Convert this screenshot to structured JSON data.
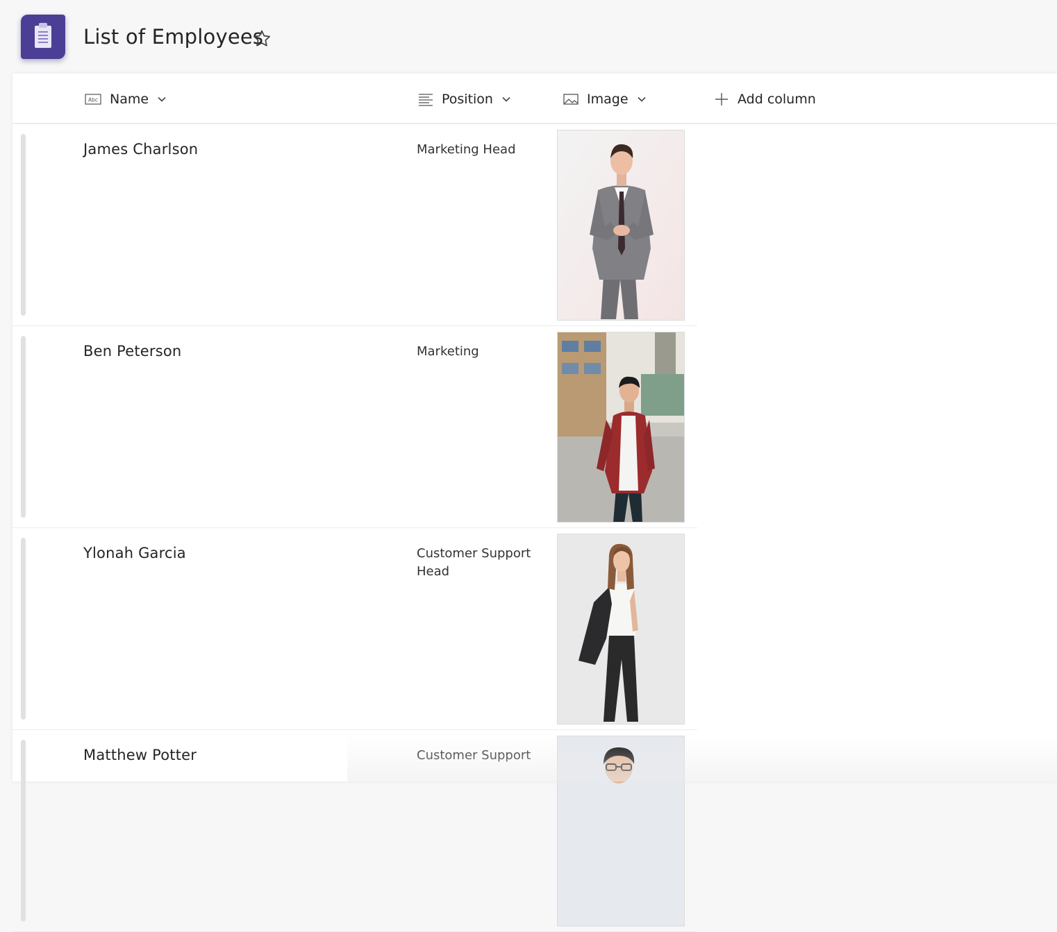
{
  "header": {
    "title": "List of Employees",
    "app_icon": "clipboard-list-icon",
    "favorite_icon": "star-outline-icon"
  },
  "columns": [
    {
      "label": "Name",
      "icon": "text-field-icon"
    },
    {
      "label": "Position",
      "icon": "multiline-text-icon"
    },
    {
      "label": "Image",
      "icon": "image-icon"
    },
    {
      "label": "Add column",
      "icon": "plus-icon"
    }
  ],
  "rows": [
    {
      "name": "James Charlson",
      "position": "Marketing Head"
    },
    {
      "name": "Ben Peterson",
      "position": "Marketing"
    },
    {
      "name": "Ylonah Garcia",
      "position": "Customer Support Head"
    },
    {
      "name": "Matthew Potter",
      "position": "Customer Support"
    }
  ],
  "colors": {
    "accent": "#4a3f94",
    "text": "#242424",
    "background": "#f7f7f8"
  }
}
